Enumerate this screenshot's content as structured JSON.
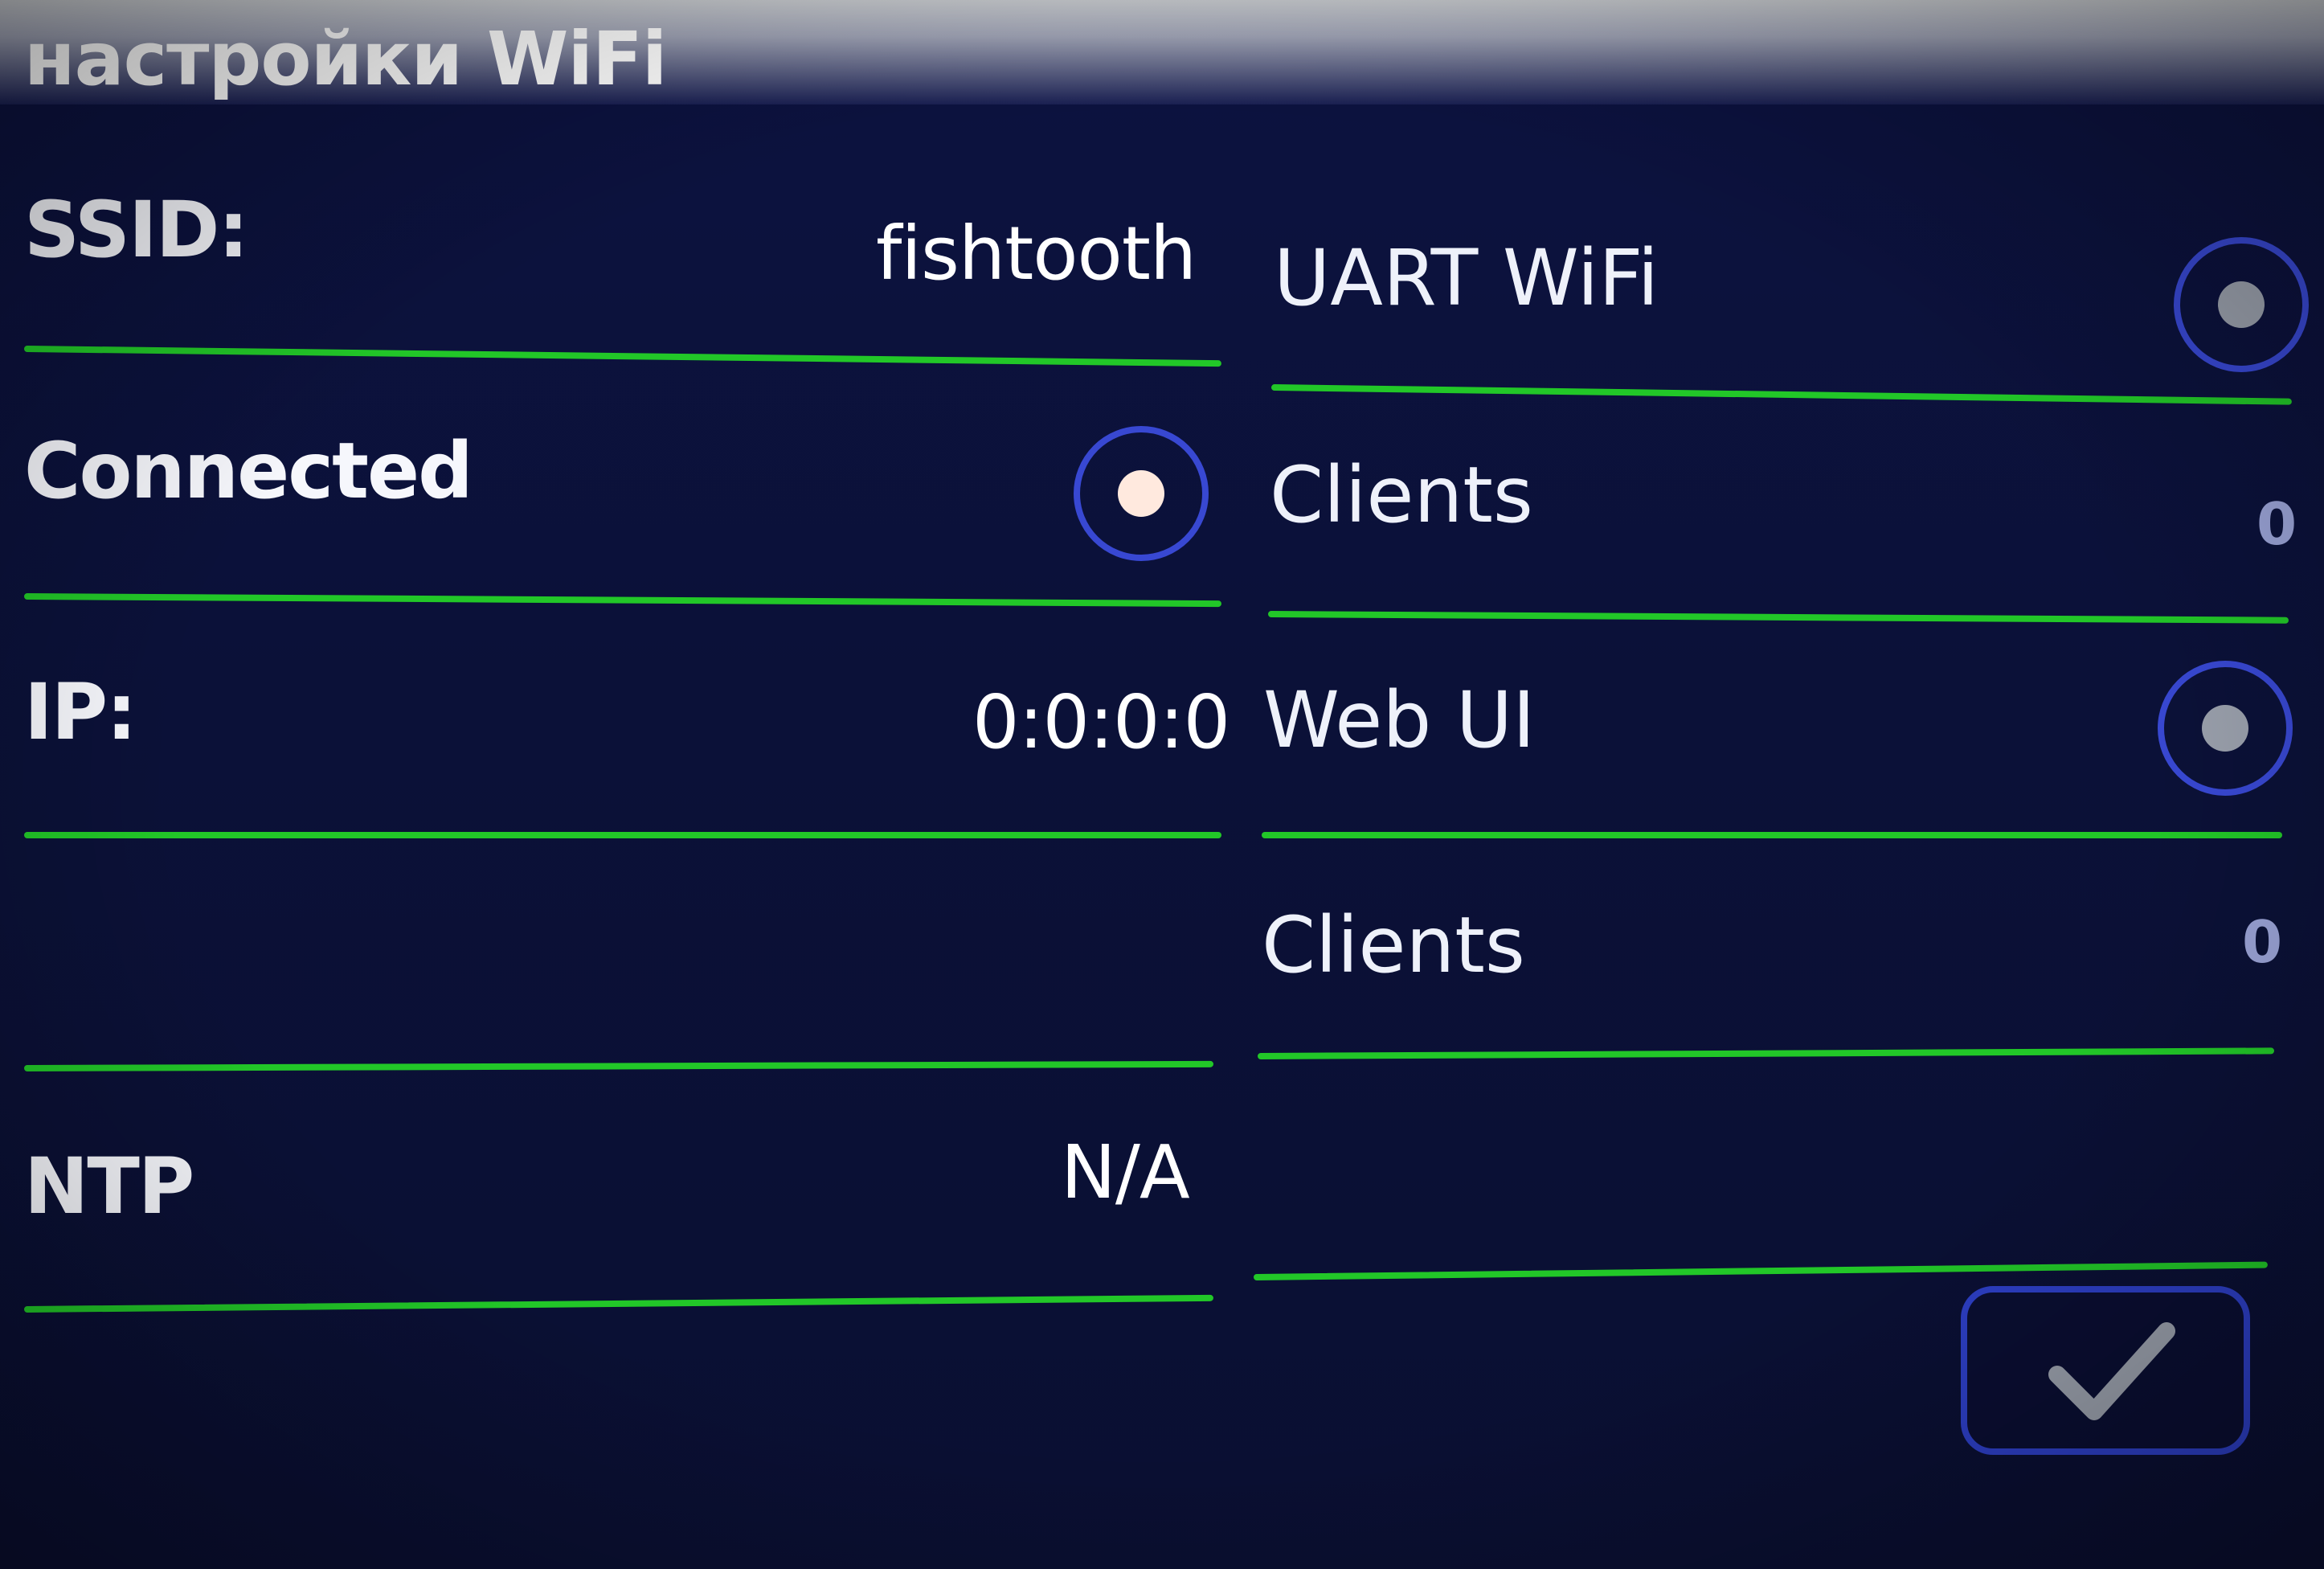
{
  "window": {
    "title": "настройки WiFi"
  },
  "left": {
    "ssid_label": "SSID:",
    "ssid_value": "fishtooth",
    "connected_label": "Connected",
    "ip_label": "IP:",
    "ip_value": "0:0:0:0",
    "ntp_label": "NTP",
    "ntp_value": "N/A"
  },
  "right": {
    "uart_label": "UART WiFi",
    "uart_clients_label": "Clients",
    "uart_clients_count": "0",
    "webui_label": "Web UI",
    "webui_clients_label": "Clients",
    "webui_clients_count": "0"
  },
  "toggles": {
    "connected": true,
    "uart_wifi": false,
    "web_ui": false
  },
  "actions": {
    "confirm_icon": "checkmark-icon"
  },
  "colors": {
    "background": "#0b1138",
    "divider": "#22c728",
    "accent_ring": "#3848d2"
  }
}
